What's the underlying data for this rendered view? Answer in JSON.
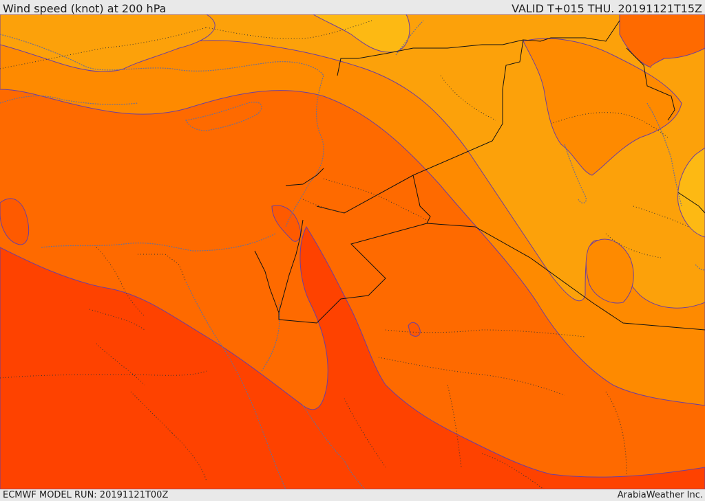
{
  "header": {
    "title": "Wind speed (knot) at 200 hPa",
    "valid": "VALID T+015 THU. 20191121T15Z"
  },
  "footer": {
    "model_run": "ECMWF MODEL RUN: 20191121T00Z",
    "credit": "ArabiaWeather Inc."
  },
  "map": {
    "variable": "wind speed",
    "level": "200 hPa",
    "unit": "knot",
    "colors": {
      "band_1": "#fdb913",
      "band_2": "#fca10a",
      "band_3": "#fe8a00",
      "band_4": "#fe6a00",
      "band_5": "#fe5a00",
      "band_6": "#fe4200",
      "contour": "#6b3fa0",
      "coastline": "#6f6f8f",
      "border": "#111111"
    }
  }
}
